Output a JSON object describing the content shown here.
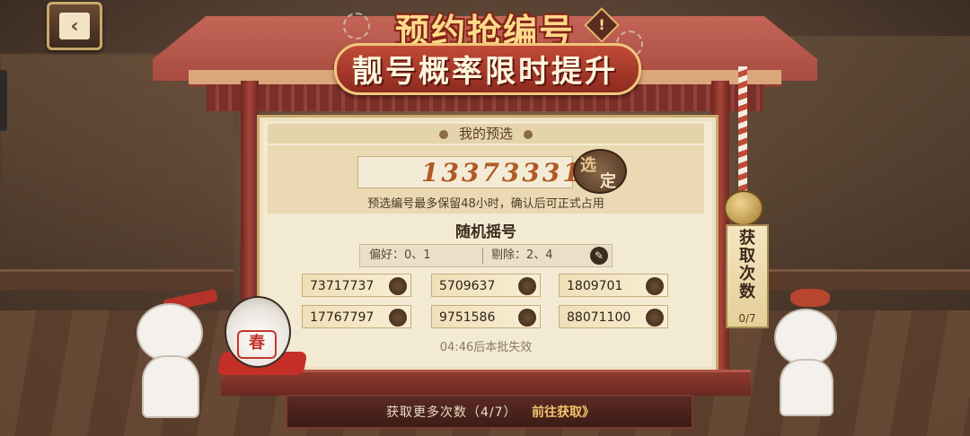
{
  "header": {
    "title_line1": "预约抢编号",
    "title_line2": "靓号概率限时提升",
    "alert_icon": "exclamation-diamond"
  },
  "back_button": {
    "icon": "chevron-left"
  },
  "preset": {
    "section_title": "我的预选",
    "number": "13373331",
    "select_label_1": "选",
    "select_label_2": "定",
    "note": "预选编号最多保留48小时，确认后可正式占用"
  },
  "random": {
    "title": "随机摇号",
    "preference": "偏好：0、1",
    "exclude": "剔除：2、4",
    "edit_icon": "pencil",
    "numbers": [
      "73717737",
      "5709637",
      "1809701",
      "17767797",
      "9751586",
      "88071100"
    ],
    "timer_note": "04:46后本批失效"
  },
  "counter": {
    "label": "获取次数",
    "count": "0/7"
  },
  "bottom": {
    "more_times": "获取更多次数（4/7）",
    "goto": "前往获取》"
  },
  "colors": {
    "roof": "#a84b40",
    "board": "#f3ead3",
    "number_text": "#b05a24",
    "accent_gold": "#f2c36b"
  }
}
